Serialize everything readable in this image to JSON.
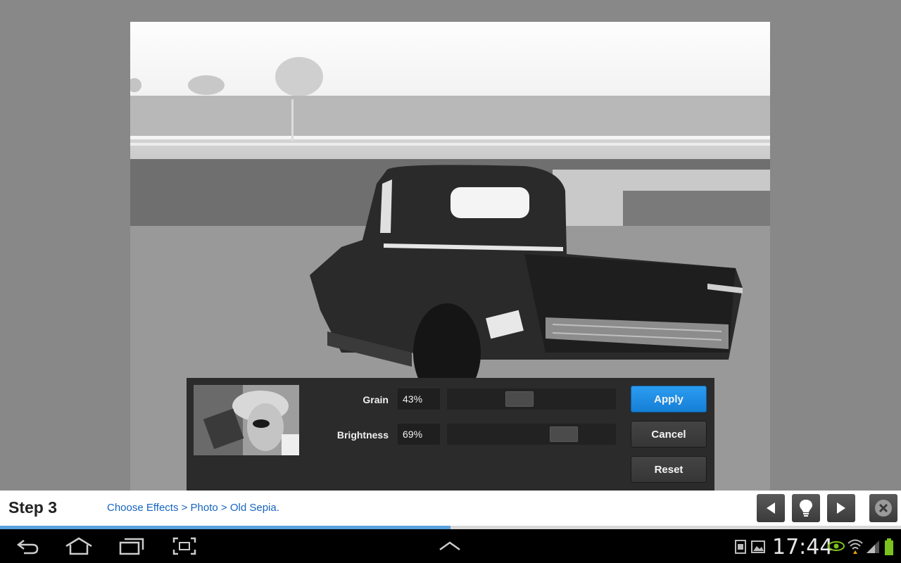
{
  "panel": {
    "grain": {
      "label": "Grain",
      "value": "43%",
      "level": 0.43
    },
    "brightness": {
      "label": "Brightness",
      "value": "69%",
      "level": 0.69
    },
    "apply_label": "Apply",
    "cancel_label": "Cancel",
    "reset_label": "Reset"
  },
  "tutorial": {
    "step": "Step 3",
    "instruction": "Choose Effects > Photo > Old Sepia.",
    "progress": 0.5
  },
  "statusbar": {
    "time": "17:44"
  },
  "icons": {
    "prev": "triangle-left-icon",
    "hint": "lightbulb-icon",
    "next": "triangle-right-icon",
    "close": "close-circle-icon",
    "back": "back-arrow-icon",
    "home": "home-icon",
    "recent": "recent-apps-icon",
    "screenshot": "screenshot-icon",
    "up": "chevron-up-icon"
  },
  "colors": {
    "accent": "#1a8ae6",
    "link": "#1565c0",
    "panel": "#2b2b2b",
    "progress": "#5aa2de"
  }
}
